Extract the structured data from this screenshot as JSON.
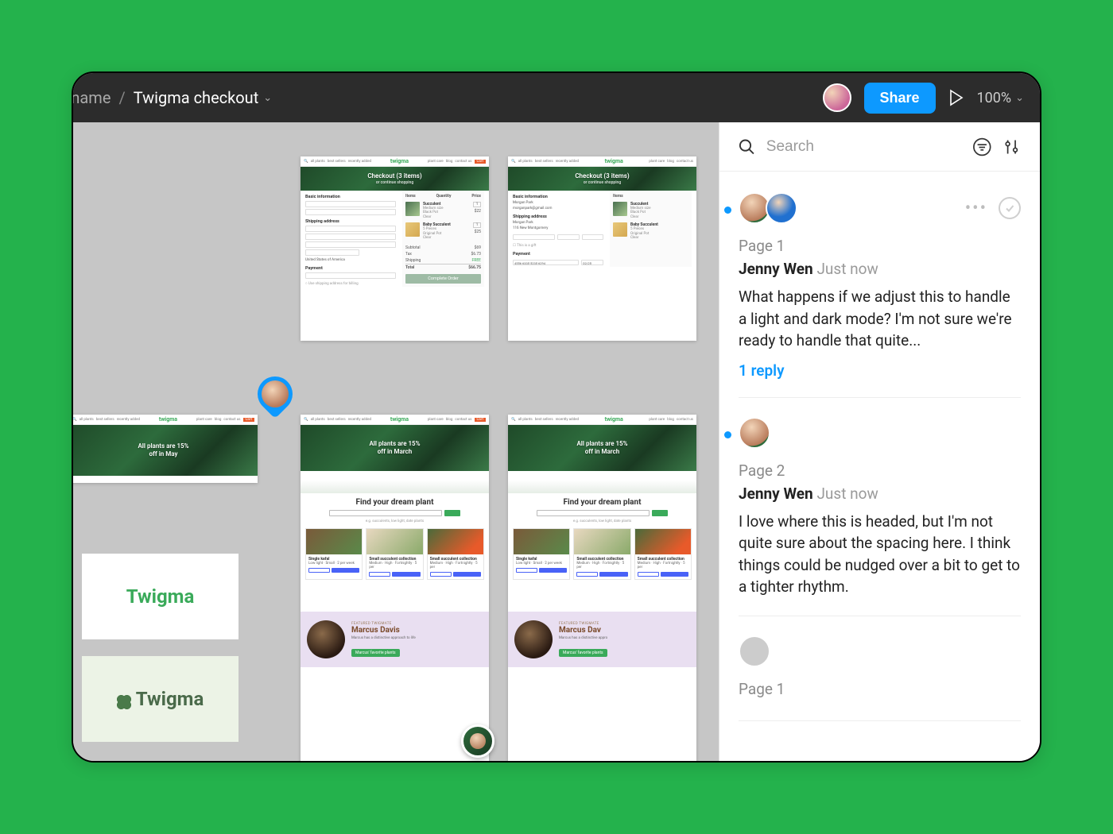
{
  "toolbar": {
    "breadcrumb_truncated": "ject name",
    "breadcrumb_current": "Twigma checkout",
    "share_label": "Share",
    "zoom": "100%"
  },
  "panel": {
    "search_placeholder": "Search"
  },
  "comments": [
    {
      "page": "Page 1",
      "author": "Jenny Wen",
      "time": "Just now",
      "message": "What happens if we adjust this to handle a light and dark mode? I'm not sure we're ready to handle that quite...",
      "replies": "1 reply",
      "unread": true,
      "avatars": 2,
      "showActions": true
    },
    {
      "page": "Page 2",
      "author": "Jenny Wen",
      "time": "Just now",
      "message": "I love where this is headed, but I'm not quite sure about the spacing here. I think things could be nudged over a bit to get to a tighter rhythm.",
      "replies": "",
      "unread": true,
      "avatars": 1,
      "showActions": false
    },
    {
      "page": "Page 1",
      "author": "",
      "time": "",
      "message": "",
      "replies": "",
      "unread": false,
      "avatars": 1,
      "grey": true
    }
  ],
  "canvas": {
    "brand": "twigma",
    "checkout": {
      "heroTitle": "Checkout (3 items)",
      "heroSub": "or continue shopping",
      "s1": "Basic information",
      "s2": "Shipping address",
      "s3": "Payment",
      "itemsLabel": "Items",
      "qtyLabel": "Quantity",
      "priceLabel": "Price",
      "item1": "Succulent",
      "item1sub": "Medium size\\nBlack Pot\\nClear",
      "price1": "$22",
      "item2": "Baby Succulent",
      "item2sub": "5 Pieces\\nOriginal Pot\\nClear",
      "price2": "$25",
      "subtotal": "Subtotal",
      "subtotalV": "$69",
      "tax": "Tax",
      "taxV": "$6.73",
      "ship": "Shipping",
      "shipV": "FREE",
      "total": "Total",
      "totalV": "$66.75",
      "complete": "Complete Order",
      "payment_card": "4556 6335 5235 6294",
      "expiry": "02/25"
    },
    "landing": {
      "heroMay": "All plants are 15%\\noff in May",
      "heroMarch": "All plants are 15%\\noff in March",
      "tagline": "Find your dream plant",
      "card1": "Single kafal",
      "card2": "Small succulent collection",
      "card3": "Small succulent collection",
      "peopleLabel": "Featured Twigmate",
      "peopleName": "Marcus Davis",
      "peopleBtn": "Marcus' favorite plants"
    },
    "logoText": "Twigma"
  }
}
